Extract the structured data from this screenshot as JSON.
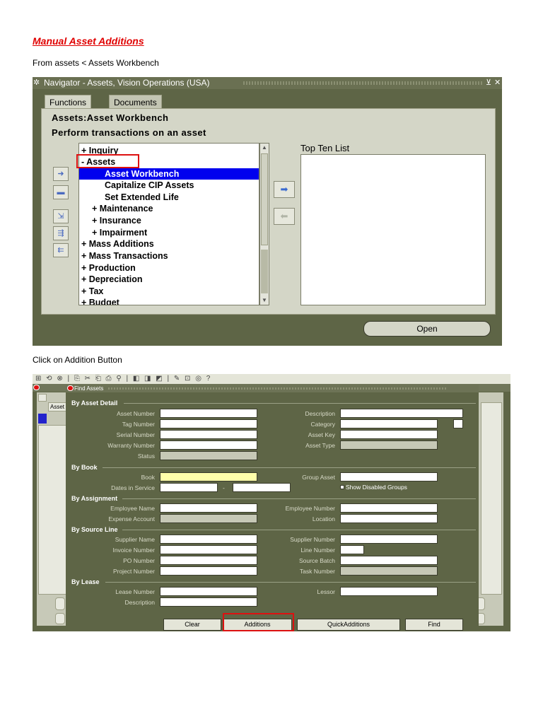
{
  "document": {
    "title": "Manual Asset Additions",
    "instruction_1": "From assets < Assets Workbench",
    "instruction_2": "Click on Addition Button"
  },
  "navigator": {
    "window_title": "Navigator - Assets, Vision Operations (USA)",
    "tabs": [
      "Functions",
      "Documents"
    ],
    "heading_1": "Assets:Asset Workbench",
    "heading_2": "Perform transactions on an asset",
    "tree": [
      {
        "label": "+  Inquiry",
        "indent": 0
      },
      {
        "label": "-  Assets",
        "indent": 0
      },
      {
        "label": "Asset Workbench",
        "indent": 2,
        "selected": true
      },
      {
        "label": "Capitalize CIP Assets",
        "indent": 2
      },
      {
        "label": "Set Extended Life",
        "indent": 2
      },
      {
        "label": "+  Maintenance",
        "indent": 1
      },
      {
        "label": "+  Insurance",
        "indent": 1
      },
      {
        "label": "+  Impairment",
        "indent": 1
      },
      {
        "label": "+  Mass Additions",
        "indent": 0
      },
      {
        "label": "+  Mass Transactions",
        "indent": 0
      },
      {
        "label": "+  Production",
        "indent": 0
      },
      {
        "label": "+  Depreciation",
        "indent": 0
      },
      {
        "label": "+  Tax",
        "indent": 0
      },
      {
        "label": "+  Budget",
        "indent": 0
      }
    ],
    "top_ten_label": "Top Ten List",
    "open_button": "Open"
  },
  "find_assets": {
    "toolbar_icons": "⊞ ⟲ ⊗ | ⎘ ✂ ⎗ ⎙ ⚲ | ◧ ◨ ◩ | ✎ ⊡ ◎ ? ",
    "background_label": "Asset",
    "window_title": "Find Assets",
    "sections": {
      "asset_detail": "By Asset Detail",
      "book": "By Book",
      "assignment": "By Assignment",
      "source_line": "By Source Line",
      "lease": "By Lease"
    },
    "labels": {
      "asset_number": "Asset Number",
      "tag_number": "Tag Number",
      "serial_number": "Serial Number",
      "warranty_number": "Warranty Number",
      "status": "Status",
      "description": "Description",
      "category": "Category",
      "asset_key": "Asset Key",
      "asset_type": "Asset Type",
      "book": "Book",
      "dates_in_service": "Dates in Service",
      "group_asset": "Group Asset",
      "show_disabled_groups": "Show Disabled Groups",
      "employee_name": "Employee Name",
      "expense_account": "Expense Account",
      "employee_number": "Employee Number",
      "location": "Location",
      "supplier_name": "Supplier Name",
      "invoice_number": "Invoice Number",
      "po_number": "PO Number",
      "project_number": "Project Number",
      "supplier_number": "Supplier Number",
      "line_number": "Line Number",
      "source_batch": "Source Batch",
      "task_number": "Task Number",
      "lease_number": "Lease Number",
      "lease_description": "Description",
      "lessor": "Lessor"
    },
    "buttons": {
      "clear": "Clear",
      "additions": "Additions",
      "quick_additions": "QuickAdditions",
      "find": "Find"
    }
  },
  "colors": {
    "title_red": "#e00000",
    "oracle_olive": "#5e6546",
    "panel_beige": "#d4d6c7",
    "selection_blue": "#0000ee",
    "highlight_box": "#dd1111",
    "required_field": "#ffffaa"
  }
}
